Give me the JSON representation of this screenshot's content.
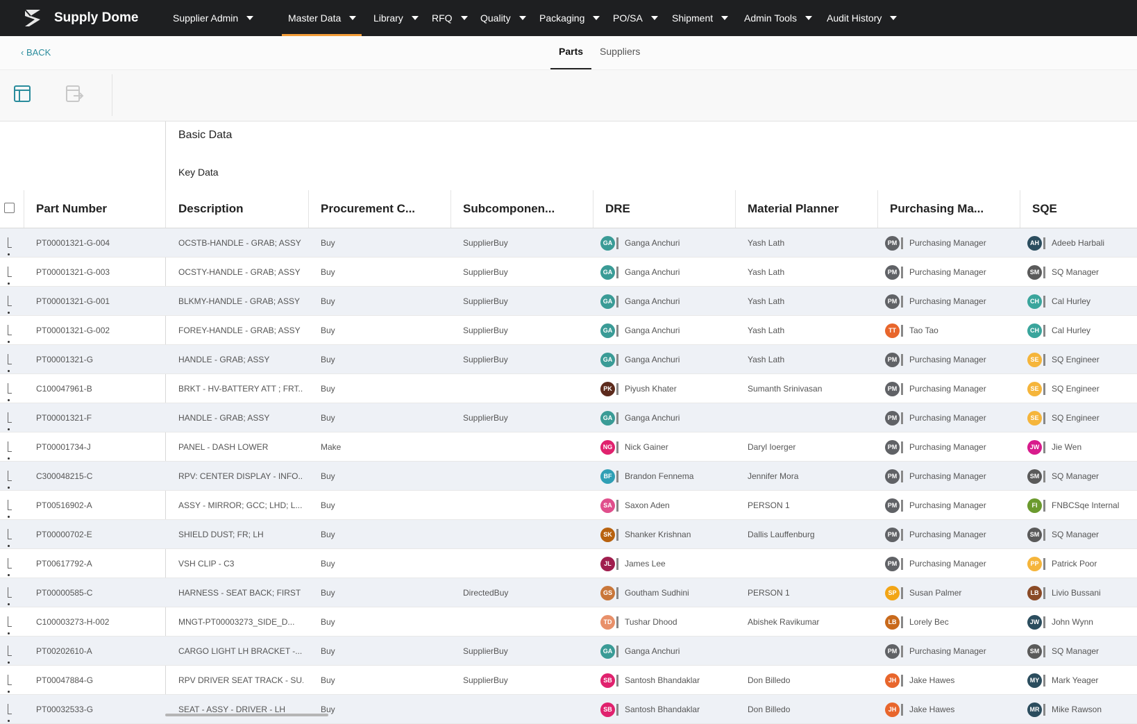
{
  "app": {
    "name": "Supply Dome",
    "logo_icon": "supply-dome-logo"
  },
  "nav": [
    {
      "label": "Supplier Admin",
      "active": false
    },
    {
      "label": "Master Data",
      "active": true
    },
    {
      "label": "Library",
      "active": false
    },
    {
      "label": "RFQ",
      "active": false
    },
    {
      "label": "Quality",
      "active": false
    },
    {
      "label": "Packaging",
      "active": false
    },
    {
      "label": "PO/SA",
      "active": false
    },
    {
      "label": "Shipment",
      "active": false
    },
    {
      "label": "Admin Tools",
      "active": false
    },
    {
      "label": "Audit History",
      "active": false
    }
  ],
  "subnav": {
    "back_label": "BACK",
    "tabs": [
      {
        "label": "Parts",
        "active": true
      },
      {
        "label": "Suppliers",
        "active": false
      }
    ]
  },
  "toolbar": {
    "tools": [
      "table-layout-icon",
      "export-icon"
    ]
  },
  "grid": {
    "group_header": "Basic Data",
    "sub_group_header": "Key Data",
    "columns": [
      "Part Number",
      "Description",
      "Procurement C...",
      "Subcomponen...",
      "DRE",
      "Material Planner",
      "Purchasing Ma...",
      "SQE"
    ],
    "rows": [
      {
        "part": "PT00001321-G-004",
        "desc": "OCSTB-HANDLE - GRAB; ASSY",
        "proc": "Buy",
        "sub": "SupplierBuy",
        "dre": {
          "i": "GA",
          "n": "Ganga Anchuri",
          "c": "#3a9b96"
        },
        "mp": "Yash Lath",
        "pm": {
          "i": "PM",
          "n": "Purchasing Manager",
          "c": "#606266"
        },
        "sqe": {
          "i": "AH",
          "n": "Adeeb Harbali",
          "c": "#2b4d5e"
        }
      },
      {
        "part": "PT00001321-G-003",
        "desc": "OCSTY-HANDLE - GRAB; ASSY",
        "proc": "Buy",
        "sub": "SupplierBuy",
        "dre": {
          "i": "GA",
          "n": "Ganga Anchuri",
          "c": "#3a9b96"
        },
        "mp": "Yash Lath",
        "pm": {
          "i": "PM",
          "n": "Purchasing Manager",
          "c": "#606266"
        },
        "sqe": {
          "i": "SM",
          "n": "SQ Manager",
          "c": "#5a5a5a"
        }
      },
      {
        "part": "PT00001321-G-001",
        "desc": "BLKMY-HANDLE - GRAB; ASSY",
        "proc": "Buy",
        "sub": "SupplierBuy",
        "dre": {
          "i": "GA",
          "n": "Ganga Anchuri",
          "c": "#3a9b96"
        },
        "mp": "Yash Lath",
        "pm": {
          "i": "PM",
          "n": "Purchasing Manager",
          "c": "#606266"
        },
        "sqe": {
          "i": "CH",
          "n": "Cal Hurley",
          "c": "#3aa59c"
        }
      },
      {
        "part": "PT00001321-G-002",
        "desc": "FOREY-HANDLE - GRAB; ASSY",
        "proc": "Buy",
        "sub": "SupplierBuy",
        "dre": {
          "i": "GA",
          "n": "Ganga Anchuri",
          "c": "#3a9b96"
        },
        "mp": "Yash Lath",
        "pm": {
          "i": "TT",
          "n": "Tao Tao",
          "c": "#e8662c"
        },
        "sqe": {
          "i": "CH",
          "n": "Cal Hurley",
          "c": "#3aa59c"
        }
      },
      {
        "part": "PT00001321-G",
        "desc": "HANDLE - GRAB; ASSY",
        "proc": "Buy",
        "sub": "SupplierBuy",
        "dre": {
          "i": "GA",
          "n": "Ganga Anchuri",
          "c": "#3a9b96"
        },
        "mp": "Yash Lath",
        "pm": {
          "i": "PM",
          "n": "Purchasing Manager",
          "c": "#606266"
        },
        "sqe": {
          "i": "SE",
          "n": "SQ Engineer",
          "c": "#f5b53b"
        }
      },
      {
        "part": "C100047961-B",
        "desc": "BRKT - HV-BATTERY ATT ; FRT...",
        "proc": "Buy",
        "sub": "",
        "dre": {
          "i": "PK",
          "n": "Piyush Khater",
          "c": "#5c2a1c"
        },
        "mp": "Sumanth Srinivasan",
        "pm": {
          "i": "PM",
          "n": "Purchasing Manager",
          "c": "#606266"
        },
        "sqe": {
          "i": "SE",
          "n": "SQ Engineer",
          "c": "#f5b53b"
        }
      },
      {
        "part": "PT00001321-F",
        "desc": "HANDLE - GRAB; ASSY",
        "proc": "Buy",
        "sub": "SupplierBuy",
        "dre": {
          "i": "GA",
          "n": "Ganga Anchuri",
          "c": "#3a9b96"
        },
        "mp": "",
        "pm": {
          "i": "PM",
          "n": "Purchasing Manager",
          "c": "#606266"
        },
        "sqe": {
          "i": "SE",
          "n": "SQ Engineer",
          "c": "#f5b53b"
        }
      },
      {
        "part": "PT00001734-J",
        "desc": "PANEL - DASH LOWER",
        "proc": "Make",
        "sub": "",
        "dre": {
          "i": "NG",
          "n": "Nick Gainer",
          "c": "#e0226e"
        },
        "mp": "Daryl Ioerger",
        "pm": {
          "i": "PM",
          "n": "Purchasing Manager",
          "c": "#606266"
        },
        "sqe": {
          "i": "JW",
          "n": "Jie Wen",
          "c": "#d81b8c"
        }
      },
      {
        "part": "C300048215-C",
        "desc": "RPV: CENTER DISPLAY - INFO...",
        "proc": "Buy",
        "sub": "",
        "dre": {
          "i": "BF",
          "n": "Brandon Fennema",
          "c": "#2f9fb5"
        },
        "mp": "Jennifer Mora",
        "pm": {
          "i": "PM",
          "n": "Purchasing Manager",
          "c": "#606266"
        },
        "sqe": {
          "i": "SM",
          "n": "SQ Manager",
          "c": "#5a5a5a"
        }
      },
      {
        "part": "PT00516902-A",
        "desc": "ASSY - MIRROR; GCC; LHD; L...",
        "proc": "Buy",
        "sub": "",
        "dre": {
          "i": "SA",
          "n": "Saxon Aden",
          "c": "#e04f8c"
        },
        "mp": "PERSON 1",
        "pm": {
          "i": "PM",
          "n": "Purchasing Manager",
          "c": "#606266"
        },
        "sqe": {
          "i": "FI",
          "n": "FNBCSqe Internal",
          "c": "#6b9a2e"
        }
      },
      {
        "part": "PT00000702-E",
        "desc": "SHIELD DUST; FR; LH",
        "proc": "Buy",
        "sub": "",
        "dre": {
          "i": "SK",
          "n": "Shanker Krishnan",
          "c": "#b8620f"
        },
        "mp": "Dallis Lauffenburg",
        "pm": {
          "i": "PM",
          "n": "Purchasing Manager",
          "c": "#606266"
        },
        "sqe": {
          "i": "SM",
          "n": "SQ Manager",
          "c": "#5a5a5a"
        }
      },
      {
        "part": "PT00617792-A",
        "desc": "VSH CLIP - C3",
        "proc": "Buy",
        "sub": "",
        "dre": {
          "i": "JL",
          "n": "James Lee",
          "c": "#a01e4e"
        },
        "mp": "",
        "pm": {
          "i": "PM",
          "n": "Purchasing Manager",
          "c": "#606266"
        },
        "sqe": {
          "i": "PP",
          "n": "Patrick Poor",
          "c": "#f5b53b"
        }
      },
      {
        "part": "PT00000585-C",
        "desc": "HARNESS - SEAT BACK; FIRST ...",
        "proc": "Buy",
        "sub": "DirectedBuy",
        "dre": {
          "i": "GS",
          "n": "Goutham Sudhini",
          "c": "#c9773a"
        },
        "mp": "PERSON 1",
        "pm": {
          "i": "SP",
          "n": "Susan Palmer",
          "c": "#f2a516"
        },
        "sqe": {
          "i": "LB",
          "n": "Livio Bussani",
          "c": "#8a4a26"
        }
      },
      {
        "part": "C100003273-H-002",
        "desc": "MNGT-PT00003273_SIDE_D...",
        "proc": "Buy",
        "sub": "",
        "dre": {
          "i": "TD",
          "n": "Tushar Dhood",
          "c": "#e8906a"
        },
        "mp": "Abishek Ravikumar",
        "pm": {
          "i": "LB",
          "n": "Lorely Bec",
          "c": "#c96a1c"
        },
        "sqe": {
          "i": "JW",
          "n": "John Wynn",
          "c": "#2b4d5e"
        }
      },
      {
        "part": "PT00202610-A",
        "desc": "CARGO LIGHT LH BRACKET -...",
        "proc": "Buy",
        "sub": "SupplierBuy",
        "dre": {
          "i": "GA",
          "n": "Ganga Anchuri",
          "c": "#3a9b96"
        },
        "mp": "",
        "pm": {
          "i": "PM",
          "n": "Purchasing Manager",
          "c": "#606266"
        },
        "sqe": {
          "i": "SM",
          "n": "SQ Manager",
          "c": "#5a5a5a"
        }
      },
      {
        "part": "PT00047884-G",
        "desc": "RPV DRIVER SEAT TRACK - SU...",
        "proc": "Buy",
        "sub": "SupplierBuy",
        "dre": {
          "i": "SB",
          "n": "Santosh Bhandaklar",
          "c": "#e0226e"
        },
        "mp": "Don Billedo",
        "pm": {
          "i": "JH",
          "n": "Jake Hawes",
          "c": "#e8662c"
        },
        "sqe": {
          "i": "MY",
          "n": "Mark Yeager",
          "c": "#2b4d5e"
        }
      },
      {
        "part": "PT00032533-G",
        "desc": "SEAT - ASSY - DRIVER - LH",
        "proc": "Buy",
        "sub": "",
        "dre": {
          "i": "SB",
          "n": "Santosh Bhandaklar",
          "c": "#e0226e"
        },
        "mp": "Don Billedo",
        "pm": {
          "i": "JH",
          "n": "Jake Hawes",
          "c": "#e8662c"
        },
        "sqe": {
          "i": "MR",
          "n": "Mike Rawson",
          "c": "#2b4d5e"
        }
      }
    ]
  }
}
